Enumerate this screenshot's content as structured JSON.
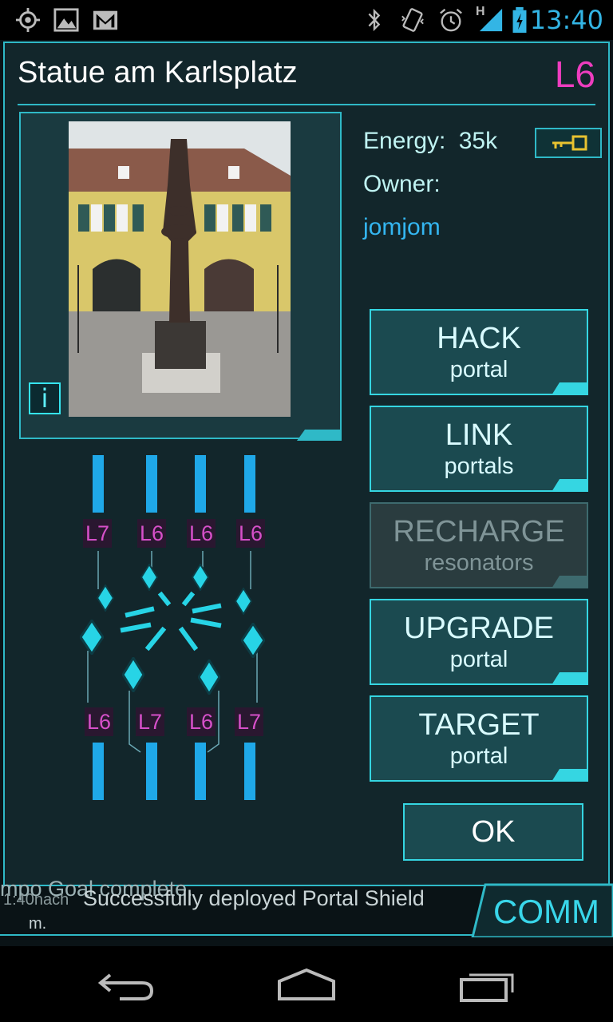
{
  "status_bar": {
    "time": "13:40",
    "icons": [
      "location-icon",
      "gallery-icon",
      "gmail-icon",
      "bluetooth-icon",
      "vibrate-icon",
      "alarm-icon",
      "signal-icon",
      "battery-icon"
    ],
    "network_label": "H"
  },
  "portal": {
    "title": "Statue am Karlsplatz",
    "level": "L6",
    "energy_label": "Energy:",
    "energy_value": "35k",
    "owner_label": "Owner:",
    "owner_name": "jomjom",
    "info_label": "i"
  },
  "actions": [
    {
      "title": "HACK",
      "subtitle": "portal",
      "enabled": true
    },
    {
      "title": "LINK",
      "subtitle": "portals",
      "enabled": true
    },
    {
      "title": "RECHARGE",
      "subtitle": "resonators",
      "enabled": false
    },
    {
      "title": "UPGRADE",
      "subtitle": "portal",
      "enabled": true
    },
    {
      "title": "TARGET",
      "subtitle": "portal",
      "enabled": true
    }
  ],
  "ok_label": "OK",
  "resonators": {
    "top": [
      "L7",
      "L6",
      "L6",
      "L6"
    ],
    "bottom": [
      "L6",
      "L7",
      "L6",
      "L7"
    ]
  },
  "comm": {
    "label": "COMM",
    "line1": "mpo Goal complete.",
    "time": "1:40nach",
    "message": "Successfully deployed Portal Shield",
    "line3": "m."
  },
  "colors": {
    "accent": "#2fb9c7",
    "level_magenta": "#ee3dbf",
    "owner_blue": "#34b6f1",
    "resonator_bar": "#1fa8e8"
  }
}
